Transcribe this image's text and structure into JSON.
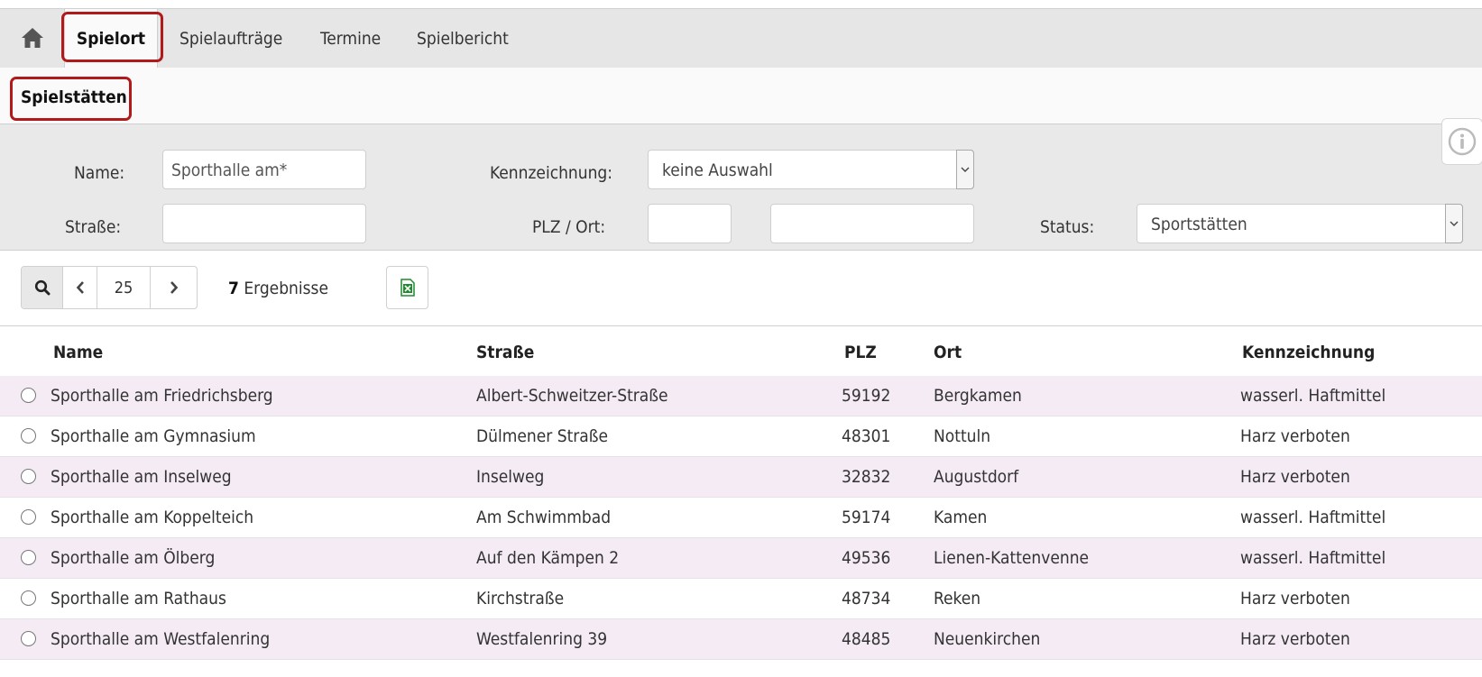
{
  "nav": {
    "home_icon": "home-icon",
    "tabs": [
      {
        "label": "Spielort",
        "active": true
      },
      {
        "label": "Spielaufträge",
        "active": false
      },
      {
        "label": "Termine",
        "active": false
      },
      {
        "label": "Spielbericht",
        "active": false
      }
    ]
  },
  "section": {
    "title": "Spielstätten"
  },
  "filter": {
    "name_label": "Name:",
    "name_value": "Sporthalle am*",
    "kennzeichnung_label": "Kennzeichnung:",
    "kennzeichnung_value": "keine Auswahl",
    "strasse_label": "Straße:",
    "strasse_value": "",
    "plz_ort_label": "PLZ / Ort:",
    "plz_value": "",
    "ort_value": "",
    "status_label": "Status:",
    "status_value": "Sportstätten"
  },
  "toolbar": {
    "page_size": "25",
    "result_count": "7",
    "result_label": "Ergebnisse"
  },
  "table": {
    "columns": [
      "Name",
      "Straße",
      "PLZ",
      "Ort",
      "Kennzeichnung"
    ],
    "rows": [
      {
        "name": "Sporthalle am Friedrichsberg",
        "strasse": "Albert-Schweitzer-Straße",
        "plz": "59192",
        "ort": "Bergkamen",
        "kennzeichnung": "wasserl. Haftmittel"
      },
      {
        "name": "Sporthalle am Gymnasium",
        "strasse": "Dülmener Straße",
        "plz": "48301",
        "ort": "Nottuln",
        "kennzeichnung": "Harz verboten"
      },
      {
        "name": "Sporthalle am Inselweg",
        "strasse": "Inselweg",
        "plz": "32832",
        "ort": "Augustdorf",
        "kennzeichnung": "Harz verboten"
      },
      {
        "name": "Sporthalle am Koppelteich",
        "strasse": "Am Schwimmbad",
        "plz": "59174",
        "ort": "Kamen",
        "kennzeichnung": "wasserl. Haftmittel"
      },
      {
        "name": "Sporthalle am Ölberg",
        "strasse": "Auf den Kämpen 2",
        "plz": "49536",
        "ort": "Lienen-Kattenvenne",
        "kennzeichnung": "wasserl. Haftmittel"
      },
      {
        "name": "Sporthalle am Rathaus",
        "strasse": "Kirchstraße",
        "plz": "48734",
        "ort": "Reken",
        "kennzeichnung": "Harz verboten"
      },
      {
        "name": "Sporthalle am Westfalenring",
        "strasse": "Westfalenring 39",
        "plz": "48485",
        "ort": "Neuenkirchen",
        "kennzeichnung": "Harz verboten"
      }
    ]
  },
  "colors": {
    "highlight": "#b11a1a",
    "row_alt": "#f4ebf4",
    "excel_green": "#1d8a2e"
  }
}
